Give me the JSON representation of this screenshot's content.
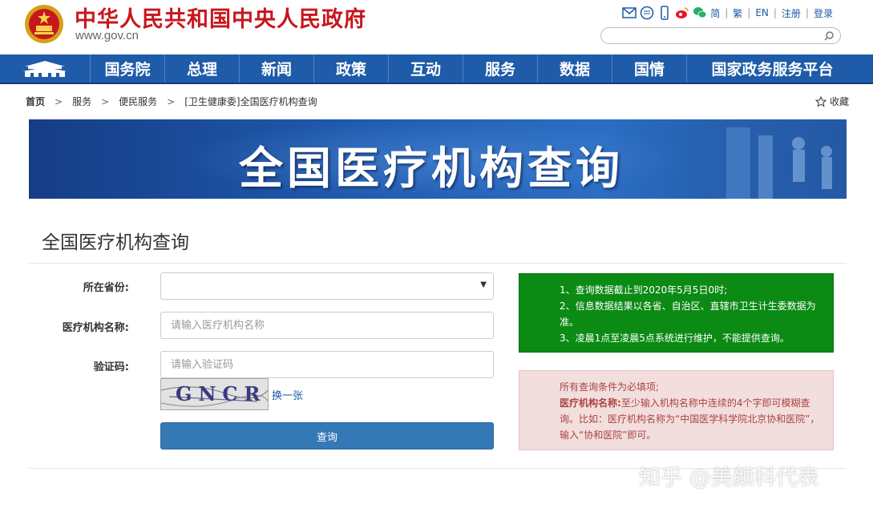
{
  "header": {
    "title": "中华人民共和国中央人民政府",
    "domain": "www.gov.cn",
    "links": [
      "简",
      "繁",
      "EN",
      "注册",
      "登录"
    ],
    "search_placeholder": ""
  },
  "nav": {
    "items": [
      "国务院",
      "总理",
      "新闻",
      "政策",
      "互动",
      "服务",
      "数据",
      "国情",
      "国家政务服务平台"
    ]
  },
  "breadcrumb": {
    "items": [
      "首页",
      "服务",
      "便民服务",
      "[卫生健康委]全国医疗机构查询"
    ],
    "favorite": "收藏"
  },
  "banner": {
    "title": "全国医疗机构查询"
  },
  "section": {
    "title": "全国医疗机构查询"
  },
  "form": {
    "province_label": "所在省份:",
    "province_value": "",
    "name_label": "医疗机构名称:",
    "name_placeholder": "请输入医疗机构名称",
    "captcha_label": "验证码:",
    "captcha_placeholder": "请输入验证码",
    "captcha_text": "GNCR",
    "refresh_label": "换一张",
    "submit_label": "查询"
  },
  "notice_green": {
    "lines": [
      "1、查询数据截止到2020年5月5日0时;",
      "2、信息数据结果以各省、自治区、直辖市卫生计生委数据为准。",
      "3、凌晨1点至凌晨5点系统进行维护，不能提供查询。"
    ]
  },
  "notice_pink": {
    "line1": "所有查询条件为必填项;",
    "bold": "医疗机构名称:",
    "line2": "至少输入机构名称中连续的4个字即可模糊查询。比如：医疗机构名称为“中国医学科学院北京协和医院”，输入“协和医院”即可。"
  },
  "watermark": "知乎 @美颜科代表",
  "colors": {
    "brand_red": "#c8161d",
    "nav_blue": "#1e5ba8",
    "notice_green": "#0b8a14",
    "notice_pink": "#f3dede",
    "button_blue": "#3578b6"
  }
}
